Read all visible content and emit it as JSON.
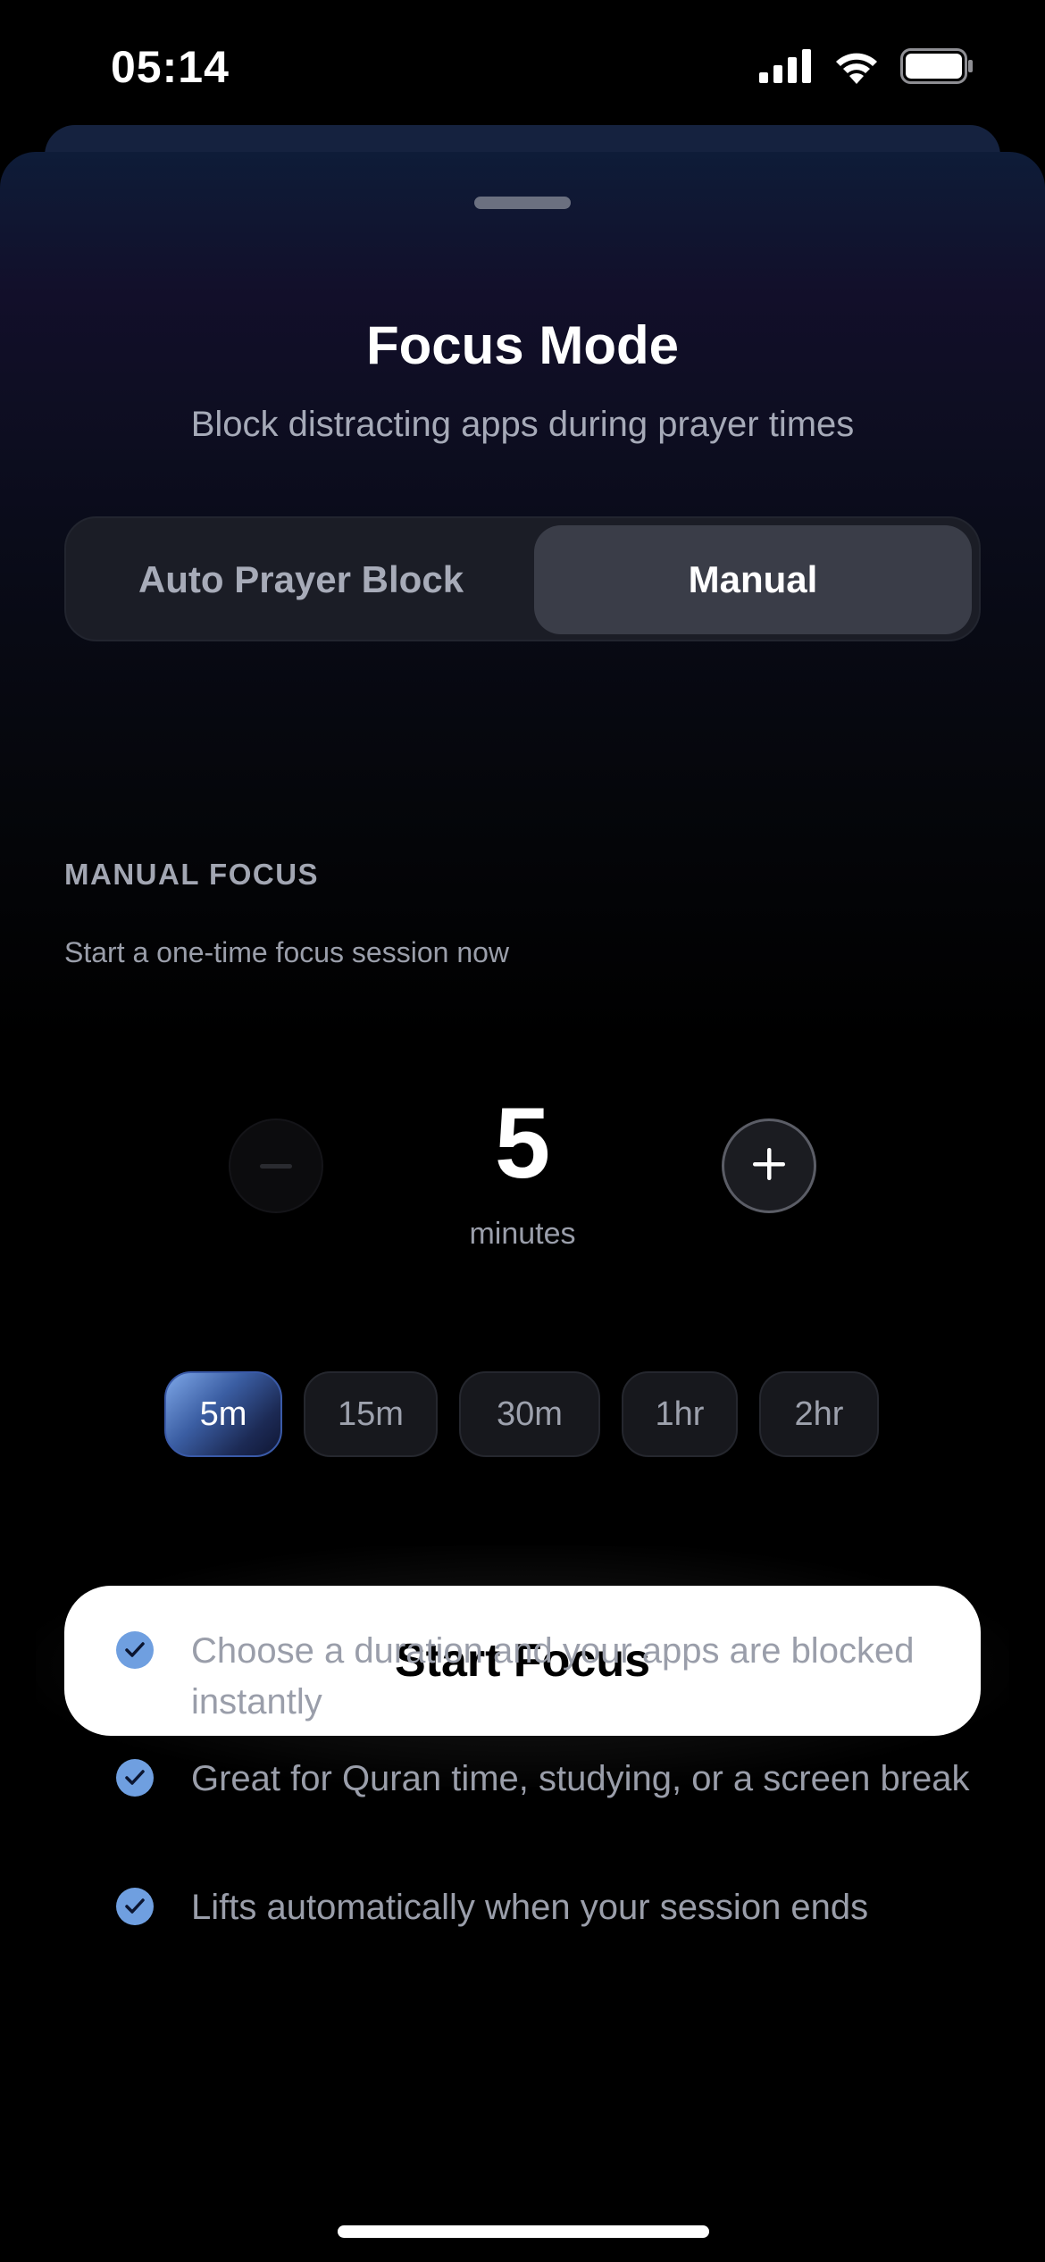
{
  "status_bar": {
    "time": "05:14",
    "icons": [
      "cellular-signal-icon",
      "wifi-icon",
      "battery-icon"
    ]
  },
  "sheet": {
    "title": "Focus Mode",
    "subtitle": "Block distracting apps during prayer times"
  },
  "segmented_control": {
    "options": [
      "Auto Prayer Block",
      "Manual"
    ],
    "selected": "Manual"
  },
  "manual_focus": {
    "heading": "MANUAL FOCUS",
    "description": "Start a one-time focus session now",
    "duration_value": "5",
    "duration_unit": "minutes",
    "decrement_enabled": false,
    "increment_enabled": true
  },
  "presets": {
    "options": [
      "5m",
      "15m",
      "30m",
      "1hr",
      "2hr"
    ],
    "selected": "5m"
  },
  "start_button": {
    "label": "Start Focus"
  },
  "features": [
    "Choose a duration and your apps are blocked instantly",
    "Great for Quran time, studying, or a screen break",
    "Lifts automatically when your session ends"
  ],
  "colors": {
    "accent": "#6f9fe0",
    "background": "#000000",
    "sheet_top": "#0e1c38",
    "segment_selected": "#3a3d48",
    "button_bg": "#ffffff"
  }
}
